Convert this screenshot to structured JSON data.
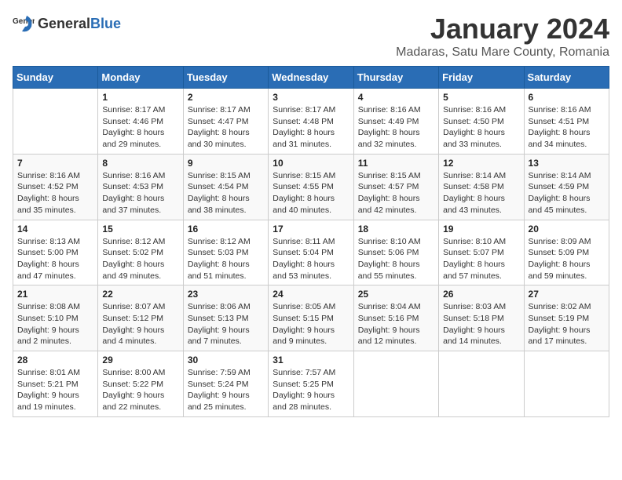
{
  "logo": {
    "general": "General",
    "blue": "Blue"
  },
  "title": "January 2024",
  "location": "Madaras, Satu Mare County, Romania",
  "days_of_week": [
    "Sunday",
    "Monday",
    "Tuesday",
    "Wednesday",
    "Thursday",
    "Friday",
    "Saturday"
  ],
  "weeks": [
    [
      {
        "day": "",
        "sunrise": "",
        "sunset": "",
        "daylight": ""
      },
      {
        "day": "1",
        "sunrise": "Sunrise: 8:17 AM",
        "sunset": "Sunset: 4:46 PM",
        "daylight": "Daylight: 8 hours and 29 minutes."
      },
      {
        "day": "2",
        "sunrise": "Sunrise: 8:17 AM",
        "sunset": "Sunset: 4:47 PM",
        "daylight": "Daylight: 8 hours and 30 minutes."
      },
      {
        "day": "3",
        "sunrise": "Sunrise: 8:17 AM",
        "sunset": "Sunset: 4:48 PM",
        "daylight": "Daylight: 8 hours and 31 minutes."
      },
      {
        "day": "4",
        "sunrise": "Sunrise: 8:16 AM",
        "sunset": "Sunset: 4:49 PM",
        "daylight": "Daylight: 8 hours and 32 minutes."
      },
      {
        "day": "5",
        "sunrise": "Sunrise: 8:16 AM",
        "sunset": "Sunset: 4:50 PM",
        "daylight": "Daylight: 8 hours and 33 minutes."
      },
      {
        "day": "6",
        "sunrise": "Sunrise: 8:16 AM",
        "sunset": "Sunset: 4:51 PM",
        "daylight": "Daylight: 8 hours and 34 minutes."
      }
    ],
    [
      {
        "day": "7",
        "sunrise": "Sunrise: 8:16 AM",
        "sunset": "Sunset: 4:52 PM",
        "daylight": "Daylight: 8 hours and 35 minutes."
      },
      {
        "day": "8",
        "sunrise": "Sunrise: 8:16 AM",
        "sunset": "Sunset: 4:53 PM",
        "daylight": "Daylight: 8 hours and 37 minutes."
      },
      {
        "day": "9",
        "sunrise": "Sunrise: 8:15 AM",
        "sunset": "Sunset: 4:54 PM",
        "daylight": "Daylight: 8 hours and 38 minutes."
      },
      {
        "day": "10",
        "sunrise": "Sunrise: 8:15 AM",
        "sunset": "Sunset: 4:55 PM",
        "daylight": "Daylight: 8 hours and 40 minutes."
      },
      {
        "day": "11",
        "sunrise": "Sunrise: 8:15 AM",
        "sunset": "Sunset: 4:57 PM",
        "daylight": "Daylight: 8 hours and 42 minutes."
      },
      {
        "day": "12",
        "sunrise": "Sunrise: 8:14 AM",
        "sunset": "Sunset: 4:58 PM",
        "daylight": "Daylight: 8 hours and 43 minutes."
      },
      {
        "day": "13",
        "sunrise": "Sunrise: 8:14 AM",
        "sunset": "Sunset: 4:59 PM",
        "daylight": "Daylight: 8 hours and 45 minutes."
      }
    ],
    [
      {
        "day": "14",
        "sunrise": "Sunrise: 8:13 AM",
        "sunset": "Sunset: 5:00 PM",
        "daylight": "Daylight: 8 hours and 47 minutes."
      },
      {
        "day": "15",
        "sunrise": "Sunrise: 8:12 AM",
        "sunset": "Sunset: 5:02 PM",
        "daylight": "Daylight: 8 hours and 49 minutes."
      },
      {
        "day": "16",
        "sunrise": "Sunrise: 8:12 AM",
        "sunset": "Sunset: 5:03 PM",
        "daylight": "Daylight: 8 hours and 51 minutes."
      },
      {
        "day": "17",
        "sunrise": "Sunrise: 8:11 AM",
        "sunset": "Sunset: 5:04 PM",
        "daylight": "Daylight: 8 hours and 53 minutes."
      },
      {
        "day": "18",
        "sunrise": "Sunrise: 8:10 AM",
        "sunset": "Sunset: 5:06 PM",
        "daylight": "Daylight: 8 hours and 55 minutes."
      },
      {
        "day": "19",
        "sunrise": "Sunrise: 8:10 AM",
        "sunset": "Sunset: 5:07 PM",
        "daylight": "Daylight: 8 hours and 57 minutes."
      },
      {
        "day": "20",
        "sunrise": "Sunrise: 8:09 AM",
        "sunset": "Sunset: 5:09 PM",
        "daylight": "Daylight: 8 hours and 59 minutes."
      }
    ],
    [
      {
        "day": "21",
        "sunrise": "Sunrise: 8:08 AM",
        "sunset": "Sunset: 5:10 PM",
        "daylight": "Daylight: 9 hours and 2 minutes."
      },
      {
        "day": "22",
        "sunrise": "Sunrise: 8:07 AM",
        "sunset": "Sunset: 5:12 PM",
        "daylight": "Daylight: 9 hours and 4 minutes."
      },
      {
        "day": "23",
        "sunrise": "Sunrise: 8:06 AM",
        "sunset": "Sunset: 5:13 PM",
        "daylight": "Daylight: 9 hours and 7 minutes."
      },
      {
        "day": "24",
        "sunrise": "Sunrise: 8:05 AM",
        "sunset": "Sunset: 5:15 PM",
        "daylight": "Daylight: 9 hours and 9 minutes."
      },
      {
        "day": "25",
        "sunrise": "Sunrise: 8:04 AM",
        "sunset": "Sunset: 5:16 PM",
        "daylight": "Daylight: 9 hours and 12 minutes."
      },
      {
        "day": "26",
        "sunrise": "Sunrise: 8:03 AM",
        "sunset": "Sunset: 5:18 PM",
        "daylight": "Daylight: 9 hours and 14 minutes."
      },
      {
        "day": "27",
        "sunrise": "Sunrise: 8:02 AM",
        "sunset": "Sunset: 5:19 PM",
        "daylight": "Daylight: 9 hours and 17 minutes."
      }
    ],
    [
      {
        "day": "28",
        "sunrise": "Sunrise: 8:01 AM",
        "sunset": "Sunset: 5:21 PM",
        "daylight": "Daylight: 9 hours and 19 minutes."
      },
      {
        "day": "29",
        "sunrise": "Sunrise: 8:00 AM",
        "sunset": "Sunset: 5:22 PM",
        "daylight": "Daylight: 9 hours and 22 minutes."
      },
      {
        "day": "30",
        "sunrise": "Sunrise: 7:59 AM",
        "sunset": "Sunset: 5:24 PM",
        "daylight": "Daylight: 9 hours and 25 minutes."
      },
      {
        "day": "31",
        "sunrise": "Sunrise: 7:57 AM",
        "sunset": "Sunset: 5:25 PM",
        "daylight": "Daylight: 9 hours and 28 minutes."
      },
      {
        "day": "",
        "sunrise": "",
        "sunset": "",
        "daylight": ""
      },
      {
        "day": "",
        "sunrise": "",
        "sunset": "",
        "daylight": ""
      },
      {
        "day": "",
        "sunrise": "",
        "sunset": "",
        "daylight": ""
      }
    ]
  ]
}
